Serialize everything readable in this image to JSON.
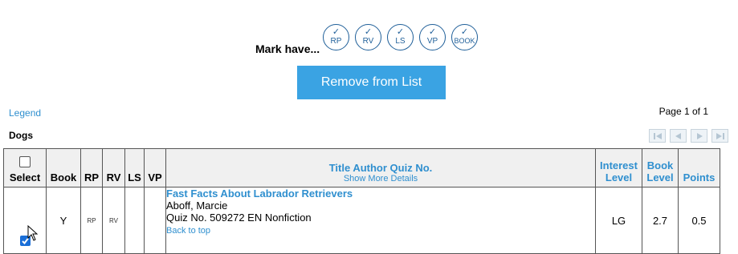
{
  "mark": {
    "label": "Mark have...",
    "buttons": [
      {
        "check": "✓",
        "label": "RP"
      },
      {
        "check": "✓",
        "label": "RV"
      },
      {
        "check": "✓",
        "label": "LS"
      },
      {
        "check": "✓",
        "label": "VP"
      },
      {
        "check": "✓",
        "label": "BOOK"
      }
    ]
  },
  "remove_button": "Remove from List",
  "legend": "Legend",
  "page_info": "Page 1 of 1",
  "list_title": "Dogs",
  "table": {
    "headers": {
      "select": "Select",
      "book": "Book",
      "rp": "RP",
      "rv": "RV",
      "ls": "LS",
      "vp": "VP",
      "title_author_quiz": "Title  Author  Quiz No.",
      "show_more": "Show More Details",
      "interest_level": "Interest Level",
      "book_level": "Book Level",
      "points": "Points"
    },
    "rows": [
      {
        "selected": true,
        "book": "Y",
        "rp": "RP",
        "rv": "RV",
        "ls": "",
        "vp": "",
        "title": "Fast Facts About Labrador Retrievers",
        "author": "Aboff, Marcie",
        "quiz": "Quiz No. 509272 EN Nonfiction",
        "back_to_top": "Back to top",
        "interest_level": "LG",
        "book_level": "2.7",
        "points": "0.5"
      }
    ]
  },
  "colors": {
    "accent": "#3aa3e3",
    "link": "#2f8fcf",
    "circle_border": "#1f5f99",
    "checkbox_checked": "#1a6fd8"
  }
}
